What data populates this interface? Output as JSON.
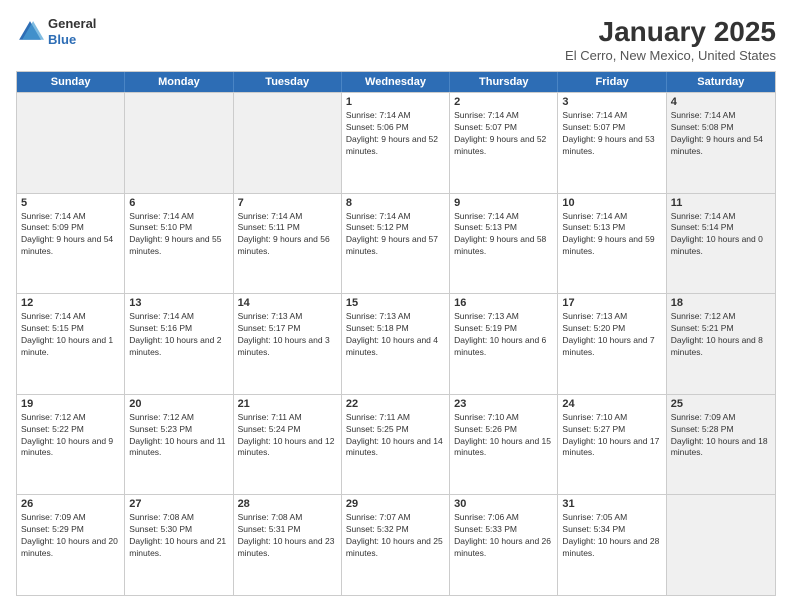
{
  "logo": {
    "general": "General",
    "blue": "Blue"
  },
  "title": "January 2025",
  "subtitle": "El Cerro, New Mexico, United States",
  "header_days": [
    "Sunday",
    "Monday",
    "Tuesday",
    "Wednesday",
    "Thursday",
    "Friday",
    "Saturday"
  ],
  "weeks": [
    [
      {
        "day": "",
        "info": "",
        "shaded": true
      },
      {
        "day": "",
        "info": "",
        "shaded": true
      },
      {
        "day": "",
        "info": "",
        "shaded": true
      },
      {
        "day": "1",
        "info": "Sunrise: 7:14 AM\nSunset: 5:06 PM\nDaylight: 9 hours and 52 minutes."
      },
      {
        "day": "2",
        "info": "Sunrise: 7:14 AM\nSunset: 5:07 PM\nDaylight: 9 hours and 52 minutes."
      },
      {
        "day": "3",
        "info": "Sunrise: 7:14 AM\nSunset: 5:07 PM\nDaylight: 9 hours and 53 minutes."
      },
      {
        "day": "4",
        "info": "Sunrise: 7:14 AM\nSunset: 5:08 PM\nDaylight: 9 hours and 54 minutes.",
        "shaded": true
      }
    ],
    [
      {
        "day": "5",
        "info": "Sunrise: 7:14 AM\nSunset: 5:09 PM\nDaylight: 9 hours and 54 minutes."
      },
      {
        "day": "6",
        "info": "Sunrise: 7:14 AM\nSunset: 5:10 PM\nDaylight: 9 hours and 55 minutes."
      },
      {
        "day": "7",
        "info": "Sunrise: 7:14 AM\nSunset: 5:11 PM\nDaylight: 9 hours and 56 minutes."
      },
      {
        "day": "8",
        "info": "Sunrise: 7:14 AM\nSunset: 5:12 PM\nDaylight: 9 hours and 57 minutes."
      },
      {
        "day": "9",
        "info": "Sunrise: 7:14 AM\nSunset: 5:13 PM\nDaylight: 9 hours and 58 minutes."
      },
      {
        "day": "10",
        "info": "Sunrise: 7:14 AM\nSunset: 5:13 PM\nDaylight: 9 hours and 59 minutes."
      },
      {
        "day": "11",
        "info": "Sunrise: 7:14 AM\nSunset: 5:14 PM\nDaylight: 10 hours and 0 minutes.",
        "shaded": true
      }
    ],
    [
      {
        "day": "12",
        "info": "Sunrise: 7:14 AM\nSunset: 5:15 PM\nDaylight: 10 hours and 1 minute."
      },
      {
        "day": "13",
        "info": "Sunrise: 7:14 AM\nSunset: 5:16 PM\nDaylight: 10 hours and 2 minutes."
      },
      {
        "day": "14",
        "info": "Sunrise: 7:13 AM\nSunset: 5:17 PM\nDaylight: 10 hours and 3 minutes."
      },
      {
        "day": "15",
        "info": "Sunrise: 7:13 AM\nSunset: 5:18 PM\nDaylight: 10 hours and 4 minutes."
      },
      {
        "day": "16",
        "info": "Sunrise: 7:13 AM\nSunset: 5:19 PM\nDaylight: 10 hours and 6 minutes."
      },
      {
        "day": "17",
        "info": "Sunrise: 7:13 AM\nSunset: 5:20 PM\nDaylight: 10 hours and 7 minutes."
      },
      {
        "day": "18",
        "info": "Sunrise: 7:12 AM\nSunset: 5:21 PM\nDaylight: 10 hours and 8 minutes.",
        "shaded": true
      }
    ],
    [
      {
        "day": "19",
        "info": "Sunrise: 7:12 AM\nSunset: 5:22 PM\nDaylight: 10 hours and 9 minutes."
      },
      {
        "day": "20",
        "info": "Sunrise: 7:12 AM\nSunset: 5:23 PM\nDaylight: 10 hours and 11 minutes."
      },
      {
        "day": "21",
        "info": "Sunrise: 7:11 AM\nSunset: 5:24 PM\nDaylight: 10 hours and 12 minutes."
      },
      {
        "day": "22",
        "info": "Sunrise: 7:11 AM\nSunset: 5:25 PM\nDaylight: 10 hours and 14 minutes."
      },
      {
        "day": "23",
        "info": "Sunrise: 7:10 AM\nSunset: 5:26 PM\nDaylight: 10 hours and 15 minutes."
      },
      {
        "day": "24",
        "info": "Sunrise: 7:10 AM\nSunset: 5:27 PM\nDaylight: 10 hours and 17 minutes."
      },
      {
        "day": "25",
        "info": "Sunrise: 7:09 AM\nSunset: 5:28 PM\nDaylight: 10 hours and 18 minutes.",
        "shaded": true
      }
    ],
    [
      {
        "day": "26",
        "info": "Sunrise: 7:09 AM\nSunset: 5:29 PM\nDaylight: 10 hours and 20 minutes."
      },
      {
        "day": "27",
        "info": "Sunrise: 7:08 AM\nSunset: 5:30 PM\nDaylight: 10 hours and 21 minutes."
      },
      {
        "day": "28",
        "info": "Sunrise: 7:08 AM\nSunset: 5:31 PM\nDaylight: 10 hours and 23 minutes."
      },
      {
        "day": "29",
        "info": "Sunrise: 7:07 AM\nSunset: 5:32 PM\nDaylight: 10 hours and 25 minutes."
      },
      {
        "day": "30",
        "info": "Sunrise: 7:06 AM\nSunset: 5:33 PM\nDaylight: 10 hours and 26 minutes."
      },
      {
        "day": "31",
        "info": "Sunrise: 7:05 AM\nSunset: 5:34 PM\nDaylight: 10 hours and 28 minutes."
      },
      {
        "day": "",
        "info": "",
        "shaded": true
      }
    ]
  ]
}
